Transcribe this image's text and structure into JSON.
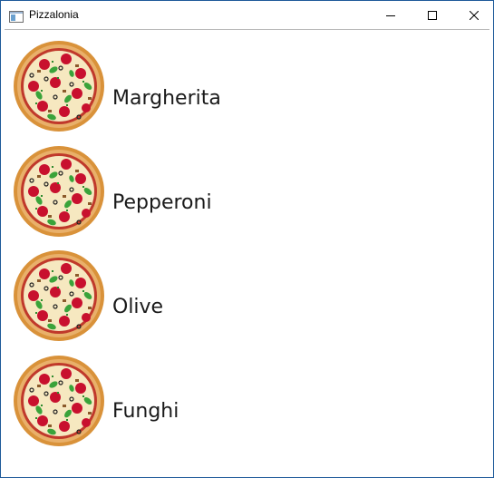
{
  "window": {
    "title": "Pizzalonia",
    "icon": "window-app-icon",
    "controls": {
      "minimize_icon": "minimize-icon",
      "maximize_icon": "maximize-icon",
      "close_icon": "close-icon"
    }
  },
  "pizzas": [
    {
      "name": "Margherita",
      "image": "pizza-image"
    },
    {
      "name": "Pepperoni",
      "image": "pizza-image"
    },
    {
      "name": "Olive",
      "image": "pizza-image"
    },
    {
      "name": "Funghi",
      "image": "pizza-image"
    }
  ],
  "colors": {
    "window_border": "#1e5a9a",
    "crust": "#d9923a",
    "sauce": "#c0392b",
    "cheese": "#f6e8c0",
    "pepperoni": "#c8102e",
    "basil": "#3aa33a"
  }
}
